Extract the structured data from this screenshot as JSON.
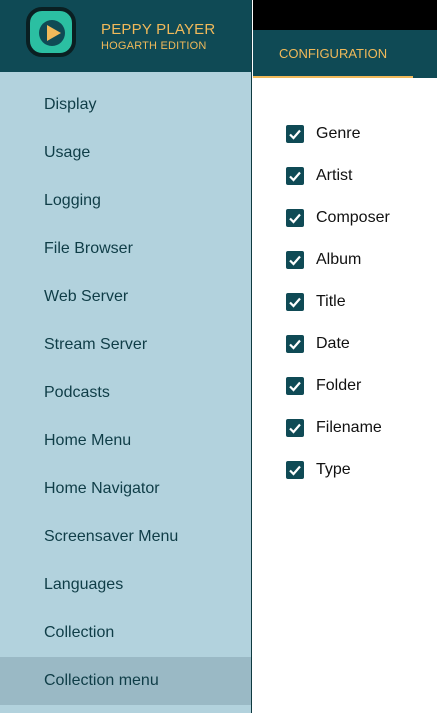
{
  "app": {
    "title": "PEPPY PLAYER",
    "subtitle": "HOGARTH EDITION"
  },
  "colors": {
    "brand_dark": "#0f4a55",
    "sidebar_bg": "#b2d2dd",
    "selected_bg": "#9ab9c5",
    "accent": "#f0b95a",
    "logo_green": "#2bbfa2"
  },
  "sidebar": {
    "items": [
      {
        "label": "Display"
      },
      {
        "label": "Usage"
      },
      {
        "label": "Logging"
      },
      {
        "label": "File Browser"
      },
      {
        "label": "Web Server"
      },
      {
        "label": "Stream Server"
      },
      {
        "label": "Podcasts"
      },
      {
        "label": "Home Menu"
      },
      {
        "label": "Home Navigator"
      },
      {
        "label": "Screensaver Menu"
      },
      {
        "label": "Languages"
      },
      {
        "label": "Collection"
      },
      {
        "label": "Collection menu",
        "selected": true
      }
    ]
  },
  "tabs": [
    {
      "label": "CONFIGURATION",
      "active": true
    }
  ],
  "options": [
    {
      "label": "Genre",
      "checked": true
    },
    {
      "label": "Artist",
      "checked": true
    },
    {
      "label": "Composer",
      "checked": true
    },
    {
      "label": "Album",
      "checked": true
    },
    {
      "label": "Title",
      "checked": true
    },
    {
      "label": "Date",
      "checked": true
    },
    {
      "label": "Folder",
      "checked": true
    },
    {
      "label": "Filename",
      "checked": true
    },
    {
      "label": "Type",
      "checked": true
    }
  ]
}
